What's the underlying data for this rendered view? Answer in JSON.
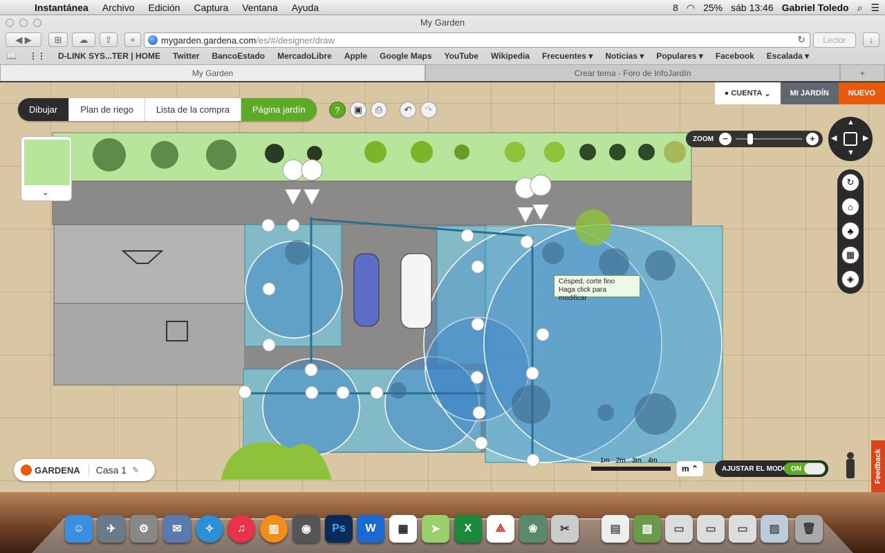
{
  "menubar": {
    "app": "Instantánea",
    "items": [
      "Archivo",
      "Edición",
      "Captura",
      "Ventana",
      "Ayuda"
    ],
    "status": {
      "badge": "8",
      "battery": "25%",
      "clock": "sáb 13:46",
      "user": "Gabriel Toledo"
    }
  },
  "browser": {
    "window_title": "My Garden",
    "url_host": "mygarden.gardena.com",
    "url_path": "/es/#/designer/draw",
    "reader": "Lector",
    "bookmarks": [
      "D-LINK SYS...TER | HOME",
      "Twitter",
      "BancoEstado",
      "MercadoLibre",
      "Apple",
      "Google Maps",
      "YouTube",
      "Wikipedia",
      "Frecuentes ▾",
      "Noticias ▾",
      "Populares ▾",
      "Facebook",
      "Escalada ▾"
    ],
    "tabs": [
      "My Garden",
      "Crear tema - Foro de InfoJardín"
    ]
  },
  "app": {
    "toolbar": [
      "Dibujar",
      "Plan de riego",
      "Lista de la compra",
      "Página jardín"
    ],
    "help": "?",
    "account": {
      "cuenta": "CUENTA",
      "mi_jardin": "MI JARDÍN",
      "nuevo": "NUEVO"
    },
    "zoom_label": "ZOOM",
    "zoom_level": 0.22,
    "tooltip": {
      "line1": "Césped, corte fino",
      "line2": "Haga click para modificar"
    },
    "brand": "GARDENA",
    "project": "Casa 1",
    "scale": [
      "1m",
      "2m",
      "3m",
      "4m"
    ],
    "unit": "m",
    "mode_label": "AJUSTAR EL MODO",
    "mode_state": "ON",
    "feedback": "Feedback"
  }
}
